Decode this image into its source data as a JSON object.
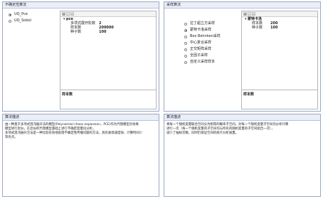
{
  "left_top": {
    "title": "不确定性算法",
    "options": [
      {
        "label": "UQ_Pce",
        "selected": true
      },
      {
        "label": "UQ_Sobol",
        "selected": false
      }
    ],
    "grid": {
      "category": "pce",
      "rows": [
        {
          "name": "多项式展开阶数",
          "value": "2"
        },
        {
          "name": "样本数",
          "value": "200000"
        },
        {
          "name": "种子数",
          "value": "100"
        }
      ],
      "description_title": "样本数"
    }
  },
  "right_top": {
    "title": "采样算法",
    "options": [
      {
        "label": "拉丁超立方采样",
        "selected": false
      },
      {
        "label": "蒙特卡洛采样",
        "selected": true
      },
      {
        "label": "Box Behnken采样",
        "selected": false
      },
      {
        "label": "中心复合采样",
        "selected": false
      },
      {
        "label": "正交矩阵采样",
        "selected": false
      },
      {
        "label": "全因子采样",
        "selected": false
      },
      {
        "label": "自定义采样样本",
        "selected": false
      }
    ],
    "grid": {
      "category": "蒙特卡洛",
      "rows": [
        {
          "name": "样本数",
          "value": "200"
        },
        {
          "name": "种子数",
          "value": "100"
        }
      ],
      "description_title": "样本数"
    }
  },
  "left_bottom": {
    "title": "算法描述",
    "lines": [
      "由一种基于多项式混沌展开法的模型(Polynomial chaos expansion，PCE)作为代理模型对仿真",
      "模型进行近似，在近似的代理模型基础上进行不确定度量化分析。",
      "多项式混沌展开方法是一种比较有效地处理不确定性传播问题的方法，具有收敛速度快、计算时间少",
      "等优点。"
    ]
  },
  "right_bottom": {
    "title": "算法描述",
    "lines": [
      "将每一个随机变量联合空间分为相等的概率子空间，对每一个随机变量子空间均分析计算",
      "进行一次（每一个随机变量的子空间均与所有的随机变量的子空间组合一次），",
      "减少了抽样次数，同时仍保证空间的统计分析质量。"
    ]
  },
  "toolbar_icons": [
    "categorized-icon",
    "sort-alpha-icon",
    "property-pages-icon"
  ]
}
